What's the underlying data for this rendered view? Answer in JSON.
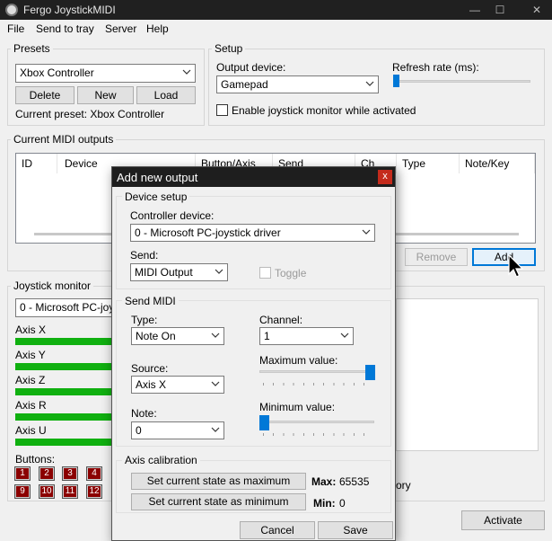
{
  "window": {
    "title": "Fergo JoystickMIDI"
  },
  "menu": [
    "File",
    "Send to tray",
    "Server",
    "Help"
  ],
  "presets": {
    "label": "Presets",
    "selected": "Xbox Controller",
    "delete": "Delete",
    "new": "New",
    "load": "Load",
    "current": "Current preset: Xbox Controller"
  },
  "setup": {
    "label": "Setup",
    "output_device_label": "Output device:",
    "output_device": "Gamepad",
    "refresh_label": "Refresh rate (ms):",
    "monitor_check": "Enable joystick monitor while activated",
    "monitor_checked": false
  },
  "outputs": {
    "label": "Current MIDI outputs",
    "columns": [
      "ID",
      "Device",
      "Button/Axis",
      "Send",
      "Ch",
      "Type",
      "Note/Key"
    ],
    "remove": "Remove",
    "add": "Add"
  },
  "monitor": {
    "label": "Joystick monitor",
    "device": "0 - Microsoft PC-joystick driver",
    "axes": [
      "Axis X",
      "Axis Y",
      "Axis Z",
      "Axis R",
      "Axis U"
    ],
    "buttons_label": "Buttons:",
    "buttons": [
      "1",
      "2",
      "3",
      "4",
      "9",
      "10",
      "11",
      "12"
    ],
    "partial_text": "ory"
  },
  "activate": "Activate",
  "dialog": {
    "title": "Add new output",
    "close": "x",
    "device_setup": {
      "label": "Device setup",
      "controller_label": "Controller device:",
      "controller": "0 - Microsoft PC-joystick driver",
      "send_label": "Send:",
      "send": "MIDI Output",
      "toggle": "Toggle"
    },
    "send_midi": {
      "label": "Send MIDI",
      "type_label": "Type:",
      "type": "Note On",
      "channel_label": "Channel:",
      "channel": "1",
      "max_label": "Maximum value:",
      "max_level": 1.0,
      "source_label": "Source:",
      "source": "Axis X",
      "min_label": "Minimum value:",
      "min_level": 0.0,
      "note_label": "Note:",
      "note": "0"
    },
    "axis_calibration": {
      "label": "Axis calibration",
      "set_max": "Set current state as maximum",
      "max_key": "Max:",
      "max_value": "65535",
      "set_min": "Set current state as minimum",
      "min_key": "Min:",
      "min_value": "0"
    },
    "cancel": "Cancel",
    "save": "Save"
  },
  "colors": {
    "accent": "#0078d7",
    "titlebar": "#202020",
    "close": "#c42b1c",
    "axis_bar": "#10b010",
    "button_box": "#8b0000"
  }
}
